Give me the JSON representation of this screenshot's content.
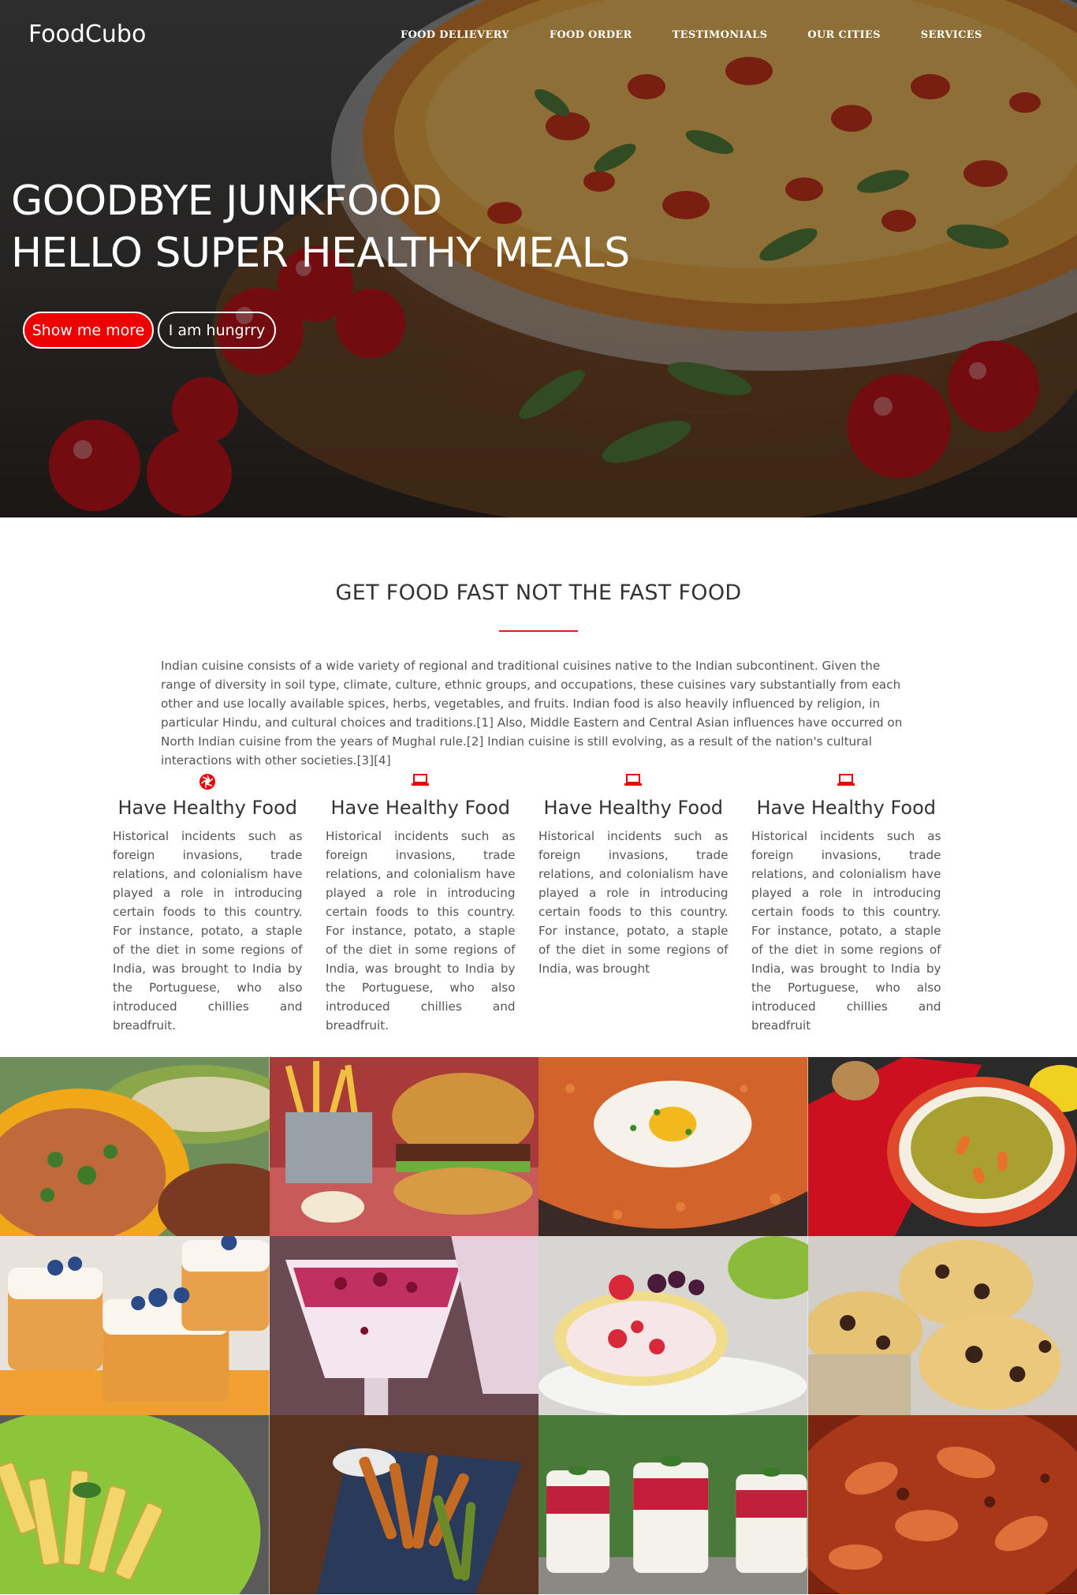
{
  "brand": {
    "logo": "FoodCubo"
  },
  "nav": {
    "items": [
      {
        "label": "FOOD DELIEVERY"
      },
      {
        "label": "FOOD ORDER"
      },
      {
        "label": "TESTIMONIALS"
      },
      {
        "label": "OUR CITIES"
      },
      {
        "label": "SERVICES"
      }
    ]
  },
  "hero": {
    "line1": "GOODBYE JUNKFOOD",
    "line2": "HELLO SUPER HEALTHY MEALS",
    "primary_button": "Show me more",
    "secondary_button": "I am hungrry"
  },
  "intro": {
    "title": "GET FOOD FAST NOT THE FAST FOOD",
    "text": "Indian cuisine consists of a wide variety of regional and traditional cuisines native to the Indian subcontinent. Given the range of diversity in soil type, climate, culture, ethnic groups, and occupations, these cuisines vary substantially from each other and use locally available spices, herbs, vegetables, and fruits. Indian food is also heavily influenced by religion, in particular Hindu, and cultural choices and traditions.[1] Also, Middle Eastern and Central Asian influences have occurred on North Indian cuisine from the years of Mughal rule.[2] Indian cuisine is still evolving, as a result of the nation's cultural interactions with other societies.[3][4]"
  },
  "features": [
    {
      "icon": "aperture-icon",
      "title": "Have Healthy Food",
      "text": "Historical incidents such as foreign invasions, trade relations, and colonialism have played a role in introducing certain foods to this country. For instance, potato, a staple of the diet in some regions of India, was brought to India by the Portuguese, who also introduced chillies and breadfruit."
    },
    {
      "icon": "laptop-icon",
      "title": "Have Healthy Food",
      "text": "Historical incidents such as foreign invasions, trade relations, and colonialism have played a role in introducing certain foods to this country. For instance, potato, a staple of the diet in some regions of India, was brought to India by the Portuguese, who also introduced chillies and breadfruit."
    },
    {
      "icon": "laptop-icon",
      "title": "Have Healthy Food",
      "text": "Historical incidents such as foreign invasions, trade relations, and colonialism have played a role in introducing certain foods to this country. For instance, potato, a staple of the diet in some regions of India, was brought"
    },
    {
      "icon": "laptop-icon",
      "title": "Have Healthy Food",
      "text": "Historical incidents such as foreign invasions, trade relations, and colonialism have played a role in introducing certain foods to this country. For instance, potato, a staple of the diet in some regions of India, was brought to India by the Portuguese, who also introduced chillies and breadfruit"
    }
  ],
  "colors": {
    "accent": "#ee0000",
    "rule": "#e21d1d",
    "heading": "#333333",
    "body_text": "#555555"
  },
  "gallery": [
    {
      "name": "curry-bowl-photo"
    },
    {
      "name": "burger-fries-photo"
    },
    {
      "name": "fried-rice-egg-photo"
    },
    {
      "name": "green-soup-photo"
    },
    {
      "name": "blueberry-cake-photo"
    },
    {
      "name": "berry-parfait-photo"
    },
    {
      "name": "strawberry-roll-cake-photo"
    },
    {
      "name": "chocolate-chip-muffins-photo"
    },
    {
      "name": "penne-pasta-photo"
    },
    {
      "name": "fried-okra-photo"
    },
    {
      "name": "panna-cotta-cups-photo"
    },
    {
      "name": "shrimp-curry-photo"
    }
  ]
}
